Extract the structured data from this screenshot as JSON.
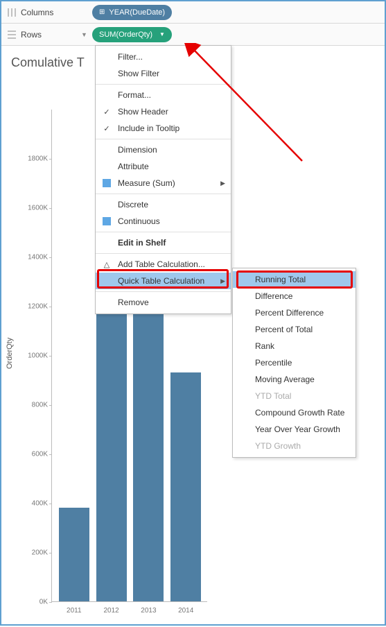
{
  "shelves": {
    "columns_label": "Columns",
    "rows_label": "Rows",
    "columns_pill": "YEAR(DueDate)",
    "rows_pill": "SUM(OrderQty)"
  },
  "title": "Comulative T",
  "ylabel": "OrderQty",
  "chart_data": {
    "type": "bar",
    "categories": [
      "2011",
      "2012",
      "2013",
      "2014"
    ],
    "values": [
      380000,
      1200000,
      1200000,
      930000
    ],
    "title": "Comulative T",
    "xlabel": "",
    "ylabel": "OrderQty",
    "ylim": [
      0,
      2000000
    ],
    "yticks": [
      "0K",
      "200K",
      "400K",
      "600K",
      "800K",
      "1000K",
      "1200K",
      "1400K",
      "1600K",
      "1800K"
    ]
  },
  "context_menu": {
    "items": [
      {
        "label": "Filter..."
      },
      {
        "label": "Show Filter"
      },
      {
        "sep": true
      },
      {
        "label": "Format..."
      },
      {
        "label": "Show Header",
        "check": true
      },
      {
        "label": "Include in Tooltip",
        "check": true
      },
      {
        "sep": true
      },
      {
        "label": "Dimension"
      },
      {
        "label": "Attribute"
      },
      {
        "label": "Measure (Sum)",
        "square": true,
        "arrow": true
      },
      {
        "sep": true
      },
      {
        "label": "Discrete"
      },
      {
        "label": "Continuous",
        "square": true
      },
      {
        "sep": true
      },
      {
        "label": "Edit in Shelf",
        "bold": true
      },
      {
        "sep": true
      },
      {
        "label": "Add Table Calculation...",
        "tri": true
      },
      {
        "label": "Quick Table Calculation",
        "arrow": true,
        "hl": true
      },
      {
        "sep": true
      },
      {
        "label": "Remove"
      }
    ]
  },
  "submenu": {
    "items": [
      {
        "label": "Running Total",
        "hl": true
      },
      {
        "label": "Difference"
      },
      {
        "label": "Percent Difference"
      },
      {
        "label": "Percent of Total"
      },
      {
        "label": "Rank"
      },
      {
        "label": "Percentile"
      },
      {
        "label": "Moving Average"
      },
      {
        "label": "YTD Total",
        "disabled": true
      },
      {
        "label": "Compound Growth Rate"
      },
      {
        "label": "Year Over Year Growth"
      },
      {
        "label": "YTD Growth",
        "disabled": true
      }
    ]
  }
}
